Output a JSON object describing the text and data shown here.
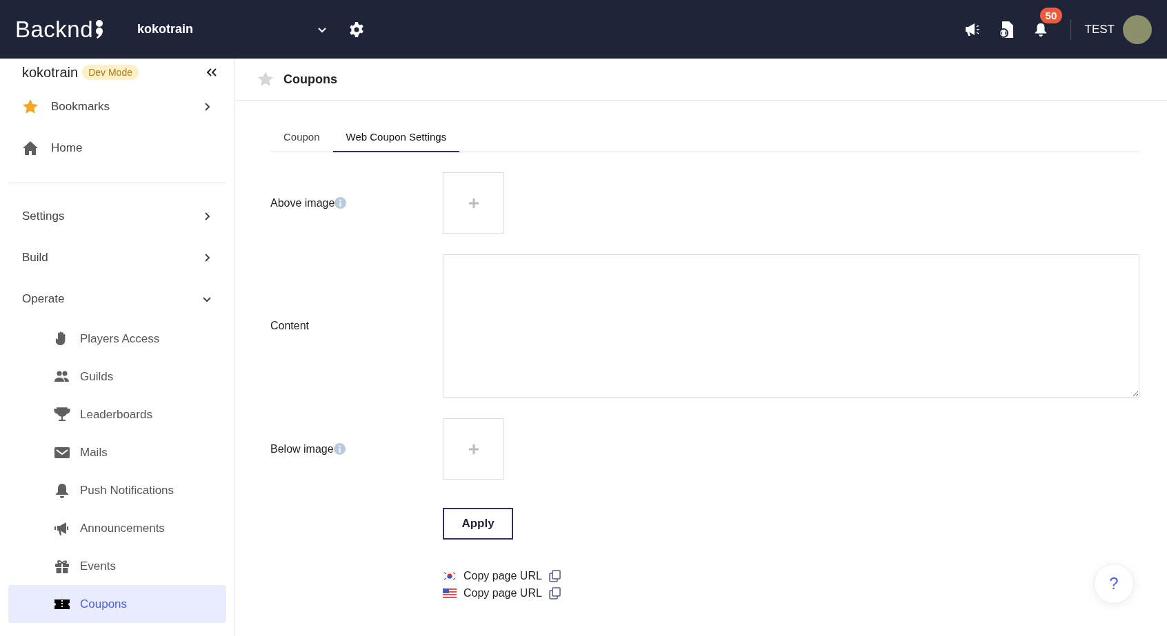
{
  "top_bar": {
    "logo": "Backnd",
    "project": "kokotrain",
    "notification_count": "50",
    "user": "TEST"
  },
  "sidebar": {
    "project": "kokotrain",
    "mode_badge": "Dev Mode",
    "quick_links": [
      {
        "label": "Bookmarks",
        "kind": "submenu"
      },
      {
        "label": "Home",
        "kind": "link"
      }
    ],
    "sections": [
      {
        "label": "Settings",
        "expanded": false
      },
      {
        "label": "Build",
        "expanded": false
      },
      {
        "label": "Operate",
        "expanded": true,
        "children": [
          {
            "label": "Players Access",
            "selected": false
          },
          {
            "label": "Guilds",
            "selected": false
          },
          {
            "label": "Leaderboards",
            "selected": false
          },
          {
            "label": "Mails",
            "selected": false
          },
          {
            "label": "Push Notifications",
            "selected": false
          },
          {
            "label": "Announcements",
            "selected": false
          },
          {
            "label": "Events",
            "selected": false
          },
          {
            "label": "Coupons",
            "selected": true
          }
        ]
      }
    ]
  },
  "page": {
    "title": "Coupons",
    "bookmarked": false,
    "tabs": [
      {
        "label": "Coupon",
        "selected": false
      },
      {
        "label": "Web Coupon Settings",
        "selected": true
      }
    ],
    "fields": [
      {
        "kind": "image",
        "label": "Above image"
      },
      {
        "kind": "textarea",
        "label": "Content"
      },
      {
        "kind": "image",
        "label": "Below image"
      }
    ],
    "apply_button": "Apply",
    "page_links": [
      {
        "label": "Copy page URL"
      },
      {
        "label": "Copy page URL"
      }
    ],
    "help_button": "?"
  }
}
